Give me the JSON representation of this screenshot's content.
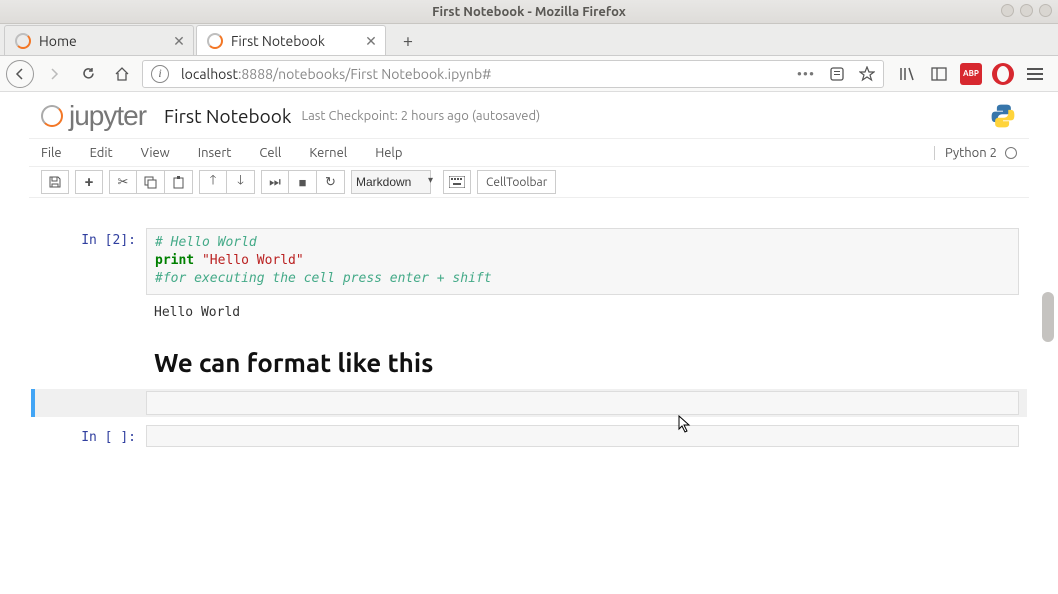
{
  "window": {
    "title": "First Notebook - Mozilla Firefox"
  },
  "tabs": [
    {
      "label": "Home",
      "active": false
    },
    {
      "label": "First Notebook",
      "active": true
    }
  ],
  "url": {
    "host": "localhost",
    "port": ":8888",
    "path": "/notebooks/First Notebook.ipynb#"
  },
  "jupyter": {
    "logo_text": "jupyter",
    "notebook_title": "First Notebook",
    "checkpoint": "Last Checkpoint: 2 hours ago (autosaved)"
  },
  "menubar": [
    "File",
    "Edit",
    "View",
    "Insert",
    "Cell",
    "Kernel",
    "Help"
  ],
  "kernel": {
    "name": "Python 2"
  },
  "toolbar": {
    "celltype_selected": "Markdown",
    "celltoolbar_label": "CellToolbar"
  },
  "cells": {
    "c1_prompt": "In [2]:",
    "c1_line1": "# Hello World",
    "c1_line2_kw": "print",
    "c1_line2_str": "\"Hello World\"",
    "c1_line3": "#for executing the cell press enter + shift",
    "c1_output": "Hello World",
    "md_heading": "We can format like this",
    "c4_prompt": "In [ ]:"
  }
}
